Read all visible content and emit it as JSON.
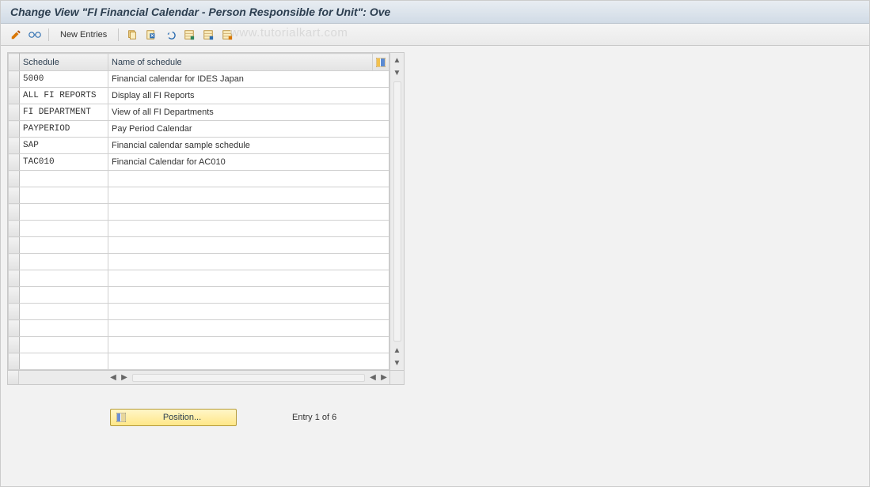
{
  "title": "Change View \"FI Financial Calendar - Person Responsible for Unit\": Ove",
  "toolbar": {
    "new_entries": "New Entries"
  },
  "watermark": "www.tutorialkart.com",
  "table": {
    "headers": {
      "schedule": "Schedule",
      "name": "Name of schedule"
    },
    "rows": [
      {
        "schedule": "5000",
        "name": "Financial calendar for IDES Japan"
      },
      {
        "schedule": "ALL FI REPORTS",
        "name": "Display all FI Reports"
      },
      {
        "schedule": "FI DEPARTMENT",
        "name": "View of all FI Departments"
      },
      {
        "schedule": "PAYPERIOD",
        "name": "Pay Period Calendar"
      },
      {
        "schedule": "SAP",
        "name": "Financial calendar sample schedule"
      },
      {
        "schedule": "TAC010",
        "name": "Financial Calendar for AC010"
      },
      {
        "schedule": "",
        "name": ""
      },
      {
        "schedule": "",
        "name": ""
      },
      {
        "schedule": "",
        "name": ""
      },
      {
        "schedule": "",
        "name": ""
      },
      {
        "schedule": "",
        "name": ""
      },
      {
        "schedule": "",
        "name": ""
      },
      {
        "schedule": "",
        "name": ""
      },
      {
        "schedule": "",
        "name": ""
      },
      {
        "schedule": "",
        "name": ""
      },
      {
        "schedule": "",
        "name": ""
      },
      {
        "schedule": "",
        "name": ""
      },
      {
        "schedule": "",
        "name": ""
      }
    ]
  },
  "position_button": "Position...",
  "entry_text": "Entry 1 of 6"
}
